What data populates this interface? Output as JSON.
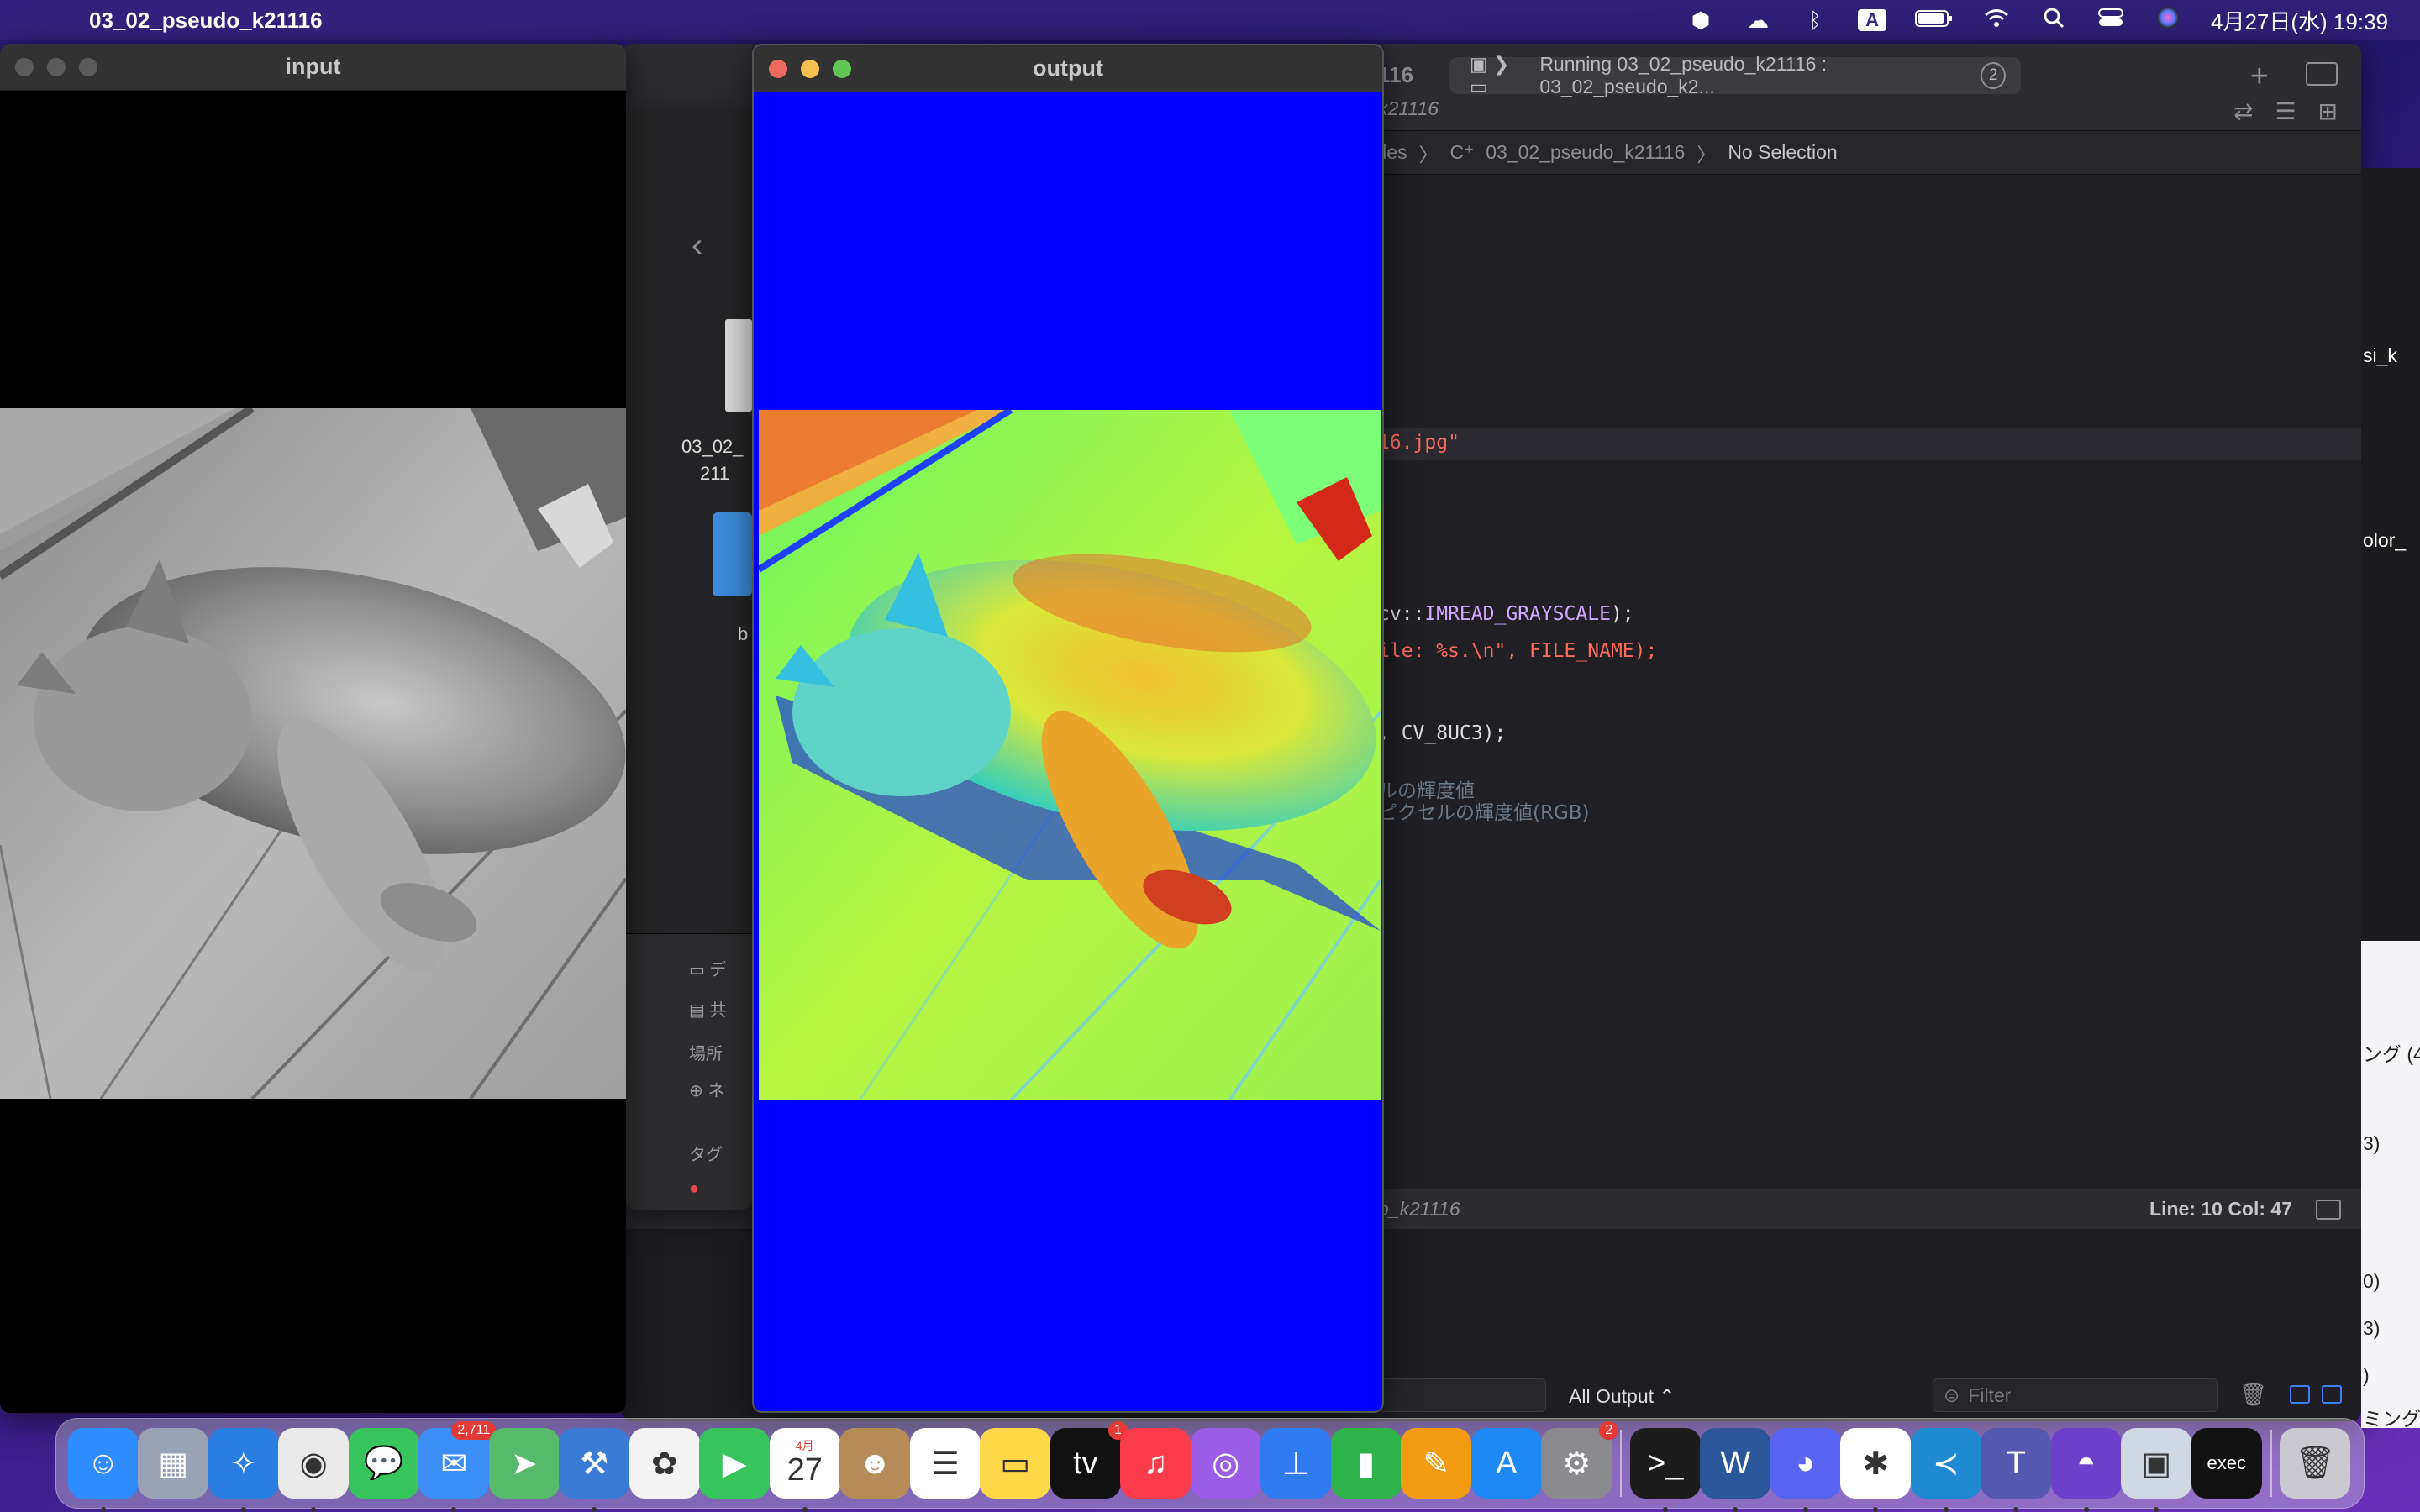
{
  "menubar": {
    "app_name": "03_02_pseudo_k21116",
    "clock": "4月27日(水) 19:39",
    "icons": [
      "apple-icon",
      "kerberos-icon",
      "cloud-alert-icon",
      "bluetooth-icon",
      "input-source-icon",
      "battery-icon",
      "wifi-icon",
      "spotlight-icon",
      "control-center-icon",
      "siri-icon"
    ],
    "input_source": "A"
  },
  "input_window": {
    "title": "input"
  },
  "output_window": {
    "title": "output"
  },
  "xcode": {
    "scheme_title": "116",
    "run_status": "Running 03_02_pseudo_k21116 : 03_02_pseudo_k2...",
    "run_badge": "2",
    "tab_label": "k21116",
    "breadcrumb": {
      "folder": "iles",
      "file": "03_02_pseudo_k21116",
      "selection": "No Selection"
    },
    "code_lines": [
      {
        "text": "16.jpg\"",
        "cls": "c-str"
      },
      {
        "text": "cv::IMREAD_GRAYSCALE);",
        "cls": "c-plain"
      },
      {
        "text": "ile: %s.\\n\", FILE_NAME);",
        "cls": "c-str"
      },
      {
        "text": ", CV_8UC3);",
        "cls": "c-plain"
      },
      {
        "text": "ルの輝度値",
        "cls": "c-jp"
      },
      {
        "text": "ピクセルの輝度値(RGB)",
        "cls": "c-jp"
      }
    ],
    "status_target": "o_k21116",
    "line_col": "Line: 10  Col: 47",
    "debug": {
      "output_selector": "All Output ⌃",
      "filter_placeholder": "Filter"
    }
  },
  "finder": {
    "doc_label_1": "03_02_",
    "doc_label_2": "211",
    "folder_label": "b",
    "sidebar_section": "場所",
    "tags_section": "タグ",
    "row_1": "デ",
    "row_2": "共",
    "row_3": "ネ"
  },
  "right_window": {
    "item_1": "si_k",
    "item_2": "olor_",
    "item_3": "ング (4",
    "item_4": "3)",
    "item_5": "0)",
    "item_6": "3)",
    "item_7": ")",
    "item_8": "ミング基"
  },
  "dock": {
    "apps": [
      {
        "name": "finder-icon",
        "color": "#2f8cff",
        "glyph": "☺",
        "running": true
      },
      {
        "name": "launchpad-icon",
        "color": "#9aa3b5",
        "glyph": "▦",
        "running": false
      },
      {
        "name": "safari-icon",
        "color": "#2a7de1",
        "glyph": "✧",
        "running": true
      },
      {
        "name": "chrome-icon",
        "color": "#e9e9e9",
        "glyph": "◉",
        "running": true
      },
      {
        "name": "messages-icon",
        "color": "#37c45c",
        "glyph": "💬",
        "running": false
      },
      {
        "name": "mail-icon",
        "color": "#3b8ef5",
        "glyph": "✉",
        "running": true,
        "badge": "2,711"
      },
      {
        "name": "maps-icon",
        "color": "#57b96b",
        "glyph": "➤",
        "running": false
      },
      {
        "name": "xcode-icon",
        "color": "#3a7bd5",
        "glyph": "⚒",
        "running": true
      },
      {
        "name": "photos-icon",
        "color": "#f3f3f3",
        "glyph": "✿",
        "running": false
      },
      {
        "name": "facetime-icon",
        "color": "#37c45c",
        "glyph": "▶",
        "running": false
      },
      {
        "name": "calendar-icon",
        "color": "#ffffff",
        "glyph": "27",
        "running": true,
        "month": "4月"
      },
      {
        "name": "contacts-icon",
        "color": "#b58b58",
        "glyph": "☻",
        "running": false
      },
      {
        "name": "reminders-icon",
        "color": "#ffffff",
        "glyph": "☰",
        "running": false
      },
      {
        "name": "notes-icon",
        "color": "#ffd84a",
        "glyph": "▭",
        "running": false
      },
      {
        "name": "tv-icon",
        "color": "#111111",
        "glyph": "tv",
        "running": false,
        "badge": "1"
      },
      {
        "name": "music-icon",
        "color": "#fa3c4c",
        "glyph": "♫",
        "running": false
      },
      {
        "name": "podcasts-icon",
        "color": "#9b5de5",
        "glyph": "◎",
        "running": false
      },
      {
        "name": "keynote-icon",
        "color": "#2f7bf2",
        "glyph": "⊥",
        "running": false
      },
      {
        "name": "numbers-icon",
        "color": "#2fb44c",
        "glyph": "▮",
        "running": false
      },
      {
        "name": "pages-icon",
        "color": "#f39c12",
        "glyph": "✎",
        "running": false
      },
      {
        "name": "app-store-icon",
        "color": "#1e88f5",
        "glyph": "A",
        "running": false
      },
      {
        "name": "system-preferences-icon",
        "color": "#8a8a8f",
        "glyph": "⚙",
        "running": false,
        "badge": "2"
      },
      {
        "name": "terminal-icon",
        "color": "#1c1c1c",
        "glyph": ">_",
        "running": true
      },
      {
        "name": "word-icon",
        "color": "#2b579a",
        "glyph": "W",
        "running": true
      },
      {
        "name": "discord-icon",
        "color": "#5865f2",
        "glyph": "◕",
        "running": true
      },
      {
        "name": "slack-icon",
        "color": "#ffffff",
        "glyph": "✱",
        "running": true
      },
      {
        "name": "vscode-icon",
        "color": "#1f8ad2",
        "glyph": "≺",
        "running": true
      },
      {
        "name": "teams-icon",
        "color": "#5558af",
        "glyph": "T",
        "running": true
      },
      {
        "name": "github-desktop-icon",
        "color": "#6e40c9",
        "glyph": "◓",
        "running": true
      },
      {
        "name": "preview-icon",
        "color": "#cfd8e3",
        "glyph": "▣",
        "running": true
      },
      {
        "name": "exec-icon",
        "color": "#111111",
        "glyph": "exec",
        "running": false
      },
      {
        "name": "trash-icon",
        "color": "#c9c9cf",
        "glyph": "🗑",
        "running": false
      }
    ]
  }
}
